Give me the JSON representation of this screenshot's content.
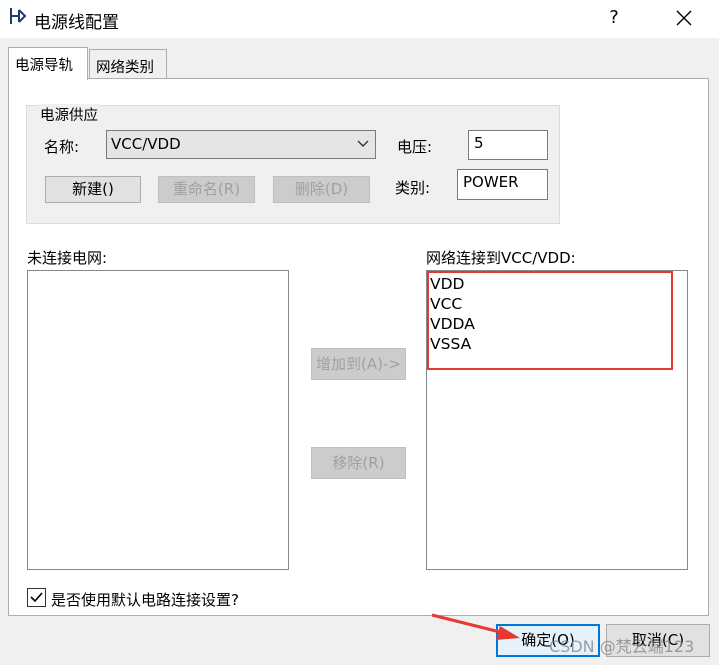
{
  "window": {
    "title": "电源线配置",
    "help": "?"
  },
  "tabs": [
    {
      "label": "电源导轨",
      "active": true
    },
    {
      "label": "网络类别",
      "active": false
    }
  ],
  "power_supply": {
    "group_title": "电源供应",
    "name_label": "名称:",
    "name_value": "VCC/VDD",
    "voltage_label": "电压:",
    "voltage_value": "5",
    "category_label": "类别:",
    "category_value": "POWER",
    "new_button": "新建()",
    "rename_button": "重命名(R)",
    "delete_button": "删除(D)"
  },
  "unconnected": {
    "label": "未连接电网:",
    "items": []
  },
  "connected": {
    "label": "网络连接到VCC/VDD:",
    "items": [
      "VDD",
      "VCC",
      "VDDA",
      "VSSA"
    ]
  },
  "actions": {
    "add_button": "增加到(A)->",
    "remove_button": "移除(R)"
  },
  "default_settings": {
    "label": "是否使用默认电路连接设置?",
    "checked": true
  },
  "footer": {
    "ok_button": "确定(O)",
    "cancel_button": "取消(C)"
  },
  "watermark": "CSDN @梵云端123",
  "colors": {
    "highlight": "#e53935",
    "focus_border": "#0078d7",
    "dialog_bg": "#f0f0f0"
  }
}
